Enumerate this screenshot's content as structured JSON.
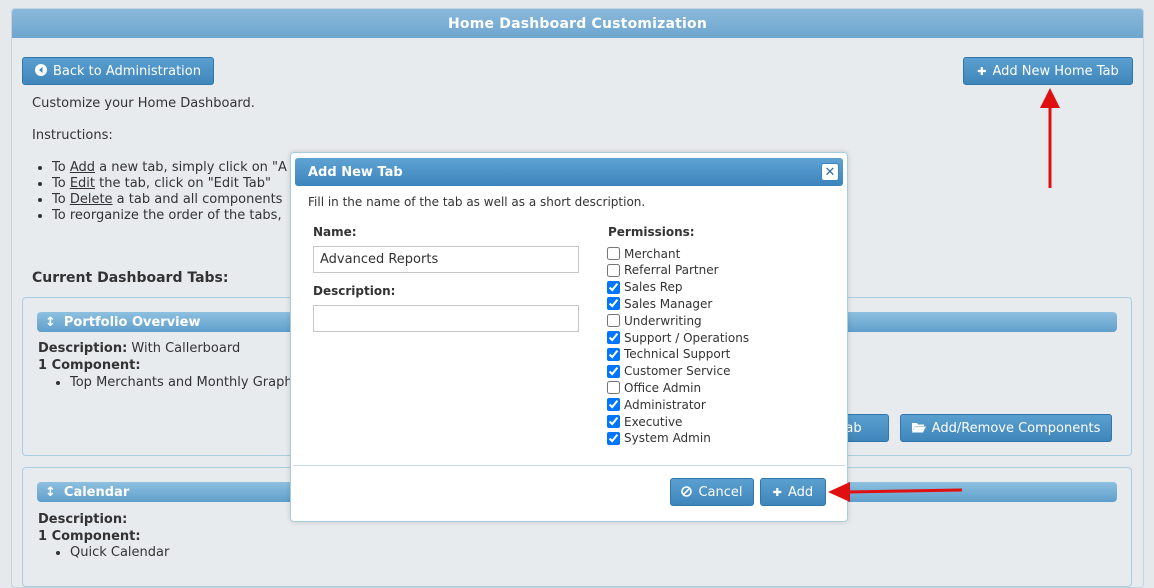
{
  "page": {
    "title": "Home Dashboard Customization"
  },
  "toolbar": {
    "back_label": "Back to Administration",
    "add_home_tab_label": "Add New Home Tab"
  },
  "intro": "Customize your Home Dashboard.",
  "instructions": {
    "heading": "Instructions:",
    "items": [
      {
        "pre": "To ",
        "link": "Add",
        "post": " a new tab, simply click on \"A"
      },
      {
        "pre": "To ",
        "link": "Edit",
        "post": " the tab, click on \"Edit Tab\""
      },
      {
        "pre": "To ",
        "link": "Delete",
        "post": " a tab and all components"
      },
      {
        "pre": "To reorganize the order of the tabs,",
        "link": "",
        "post": ""
      }
    ]
  },
  "current_tabs": {
    "heading": "Current Dashboard Tabs:",
    "tabs": [
      {
        "title": "Portfolio Overview",
        "desc_label": "Description:",
        "desc_value": "With Callerboard",
        "component_label": "1 Component:",
        "components": [
          "Top Merchants and Monthly Graph"
        ],
        "edit_label_partial": "t Tab",
        "add_remove_label": "Add/Remove Components"
      },
      {
        "title": "Calendar",
        "desc_label": "Description:",
        "desc_value": "",
        "component_label": "1 Component:",
        "components": [
          "Quick Calendar"
        ]
      }
    ]
  },
  "modal": {
    "title": "Add New Tab",
    "intro": "Fill in the name of the tab as well as a short description.",
    "name_label": "Name:",
    "name_value": "Advanced Reports",
    "description_label": "Description:",
    "description_value": "",
    "permissions_label": "Permissions:",
    "permissions": [
      {
        "label": "Merchant",
        "checked": false
      },
      {
        "label": "Referral Partner",
        "checked": false
      },
      {
        "label": "Sales Rep",
        "checked": true
      },
      {
        "label": "Sales Manager",
        "checked": true
      },
      {
        "label": "Underwriting",
        "checked": false
      },
      {
        "label": "Support / Operations",
        "checked": true
      },
      {
        "label": "Technical Support",
        "checked": true
      },
      {
        "label": "Customer Service",
        "checked": true
      },
      {
        "label": "Office Admin",
        "checked": false
      },
      {
        "label": "Administrator",
        "checked": true
      },
      {
        "label": "Executive",
        "checked": true
      },
      {
        "label": "System Admin",
        "checked": true
      }
    ],
    "cancel_label": "Cancel",
    "add_label": "Add"
  },
  "colors": {
    "accent": "#3f86bb",
    "header": "#7cb0d6",
    "arrow": "#e01010"
  },
  "icons": {
    "back": "circle-left-icon",
    "plus": "plus-icon",
    "close": "close-icon",
    "sort": "sort-icon",
    "folder": "folder-open-icon",
    "cancel": "ban-icon"
  }
}
